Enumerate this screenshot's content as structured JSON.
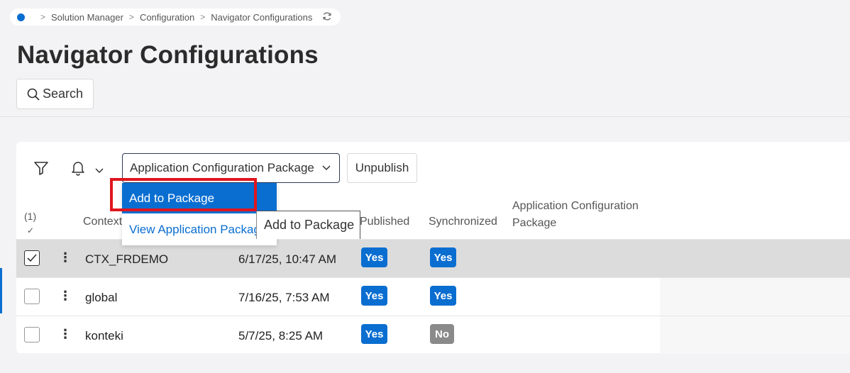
{
  "breadcrumb": {
    "items": [
      "Solution Manager",
      "Configuration",
      "Navigator Configurations"
    ],
    "separator": ">",
    "refresh_icon": "refresh-icon"
  },
  "page": {
    "title": "Navigator Configurations"
  },
  "search": {
    "label": "Search",
    "icon": "search-icon"
  },
  "toolbar": {
    "filter_icon": "filter-icon",
    "bell_icon": "bell-icon",
    "dropdown_label": "Application Configuration Package",
    "unpublish_label": "Unpublish"
  },
  "menu": {
    "items": [
      {
        "label": "Add to Package",
        "selected": true
      },
      {
        "label": "View Application Package"
      }
    ],
    "tooltip": "Add to Package"
  },
  "table": {
    "selected_count": "(1)",
    "select_mark": "✓",
    "headers": {
      "context": "Context",
      "published": "Published",
      "synchronized": "Synchronized",
      "package_line1": "Application Configuration",
      "package_line2": "Package"
    },
    "rows": [
      {
        "context": "CTX_FRDEMO",
        "date": "6/17/25, 10:47 AM",
        "published": "Yes",
        "synchronized": "Yes",
        "checked": true
      },
      {
        "context": "global",
        "date": "7/16/25, 7:53 AM",
        "published": "Yes",
        "synchronized": "Yes",
        "checked": false
      },
      {
        "context": "konteki",
        "date": "5/7/25, 8:25 AM",
        "published": "Yes",
        "synchronized": "No",
        "checked": false
      }
    ]
  },
  "colors": {
    "accent": "#0a6ed1",
    "highlight_box": "#e0161e",
    "badge_no": "#8a8a8a",
    "selected_row": "#dcdcdc"
  }
}
